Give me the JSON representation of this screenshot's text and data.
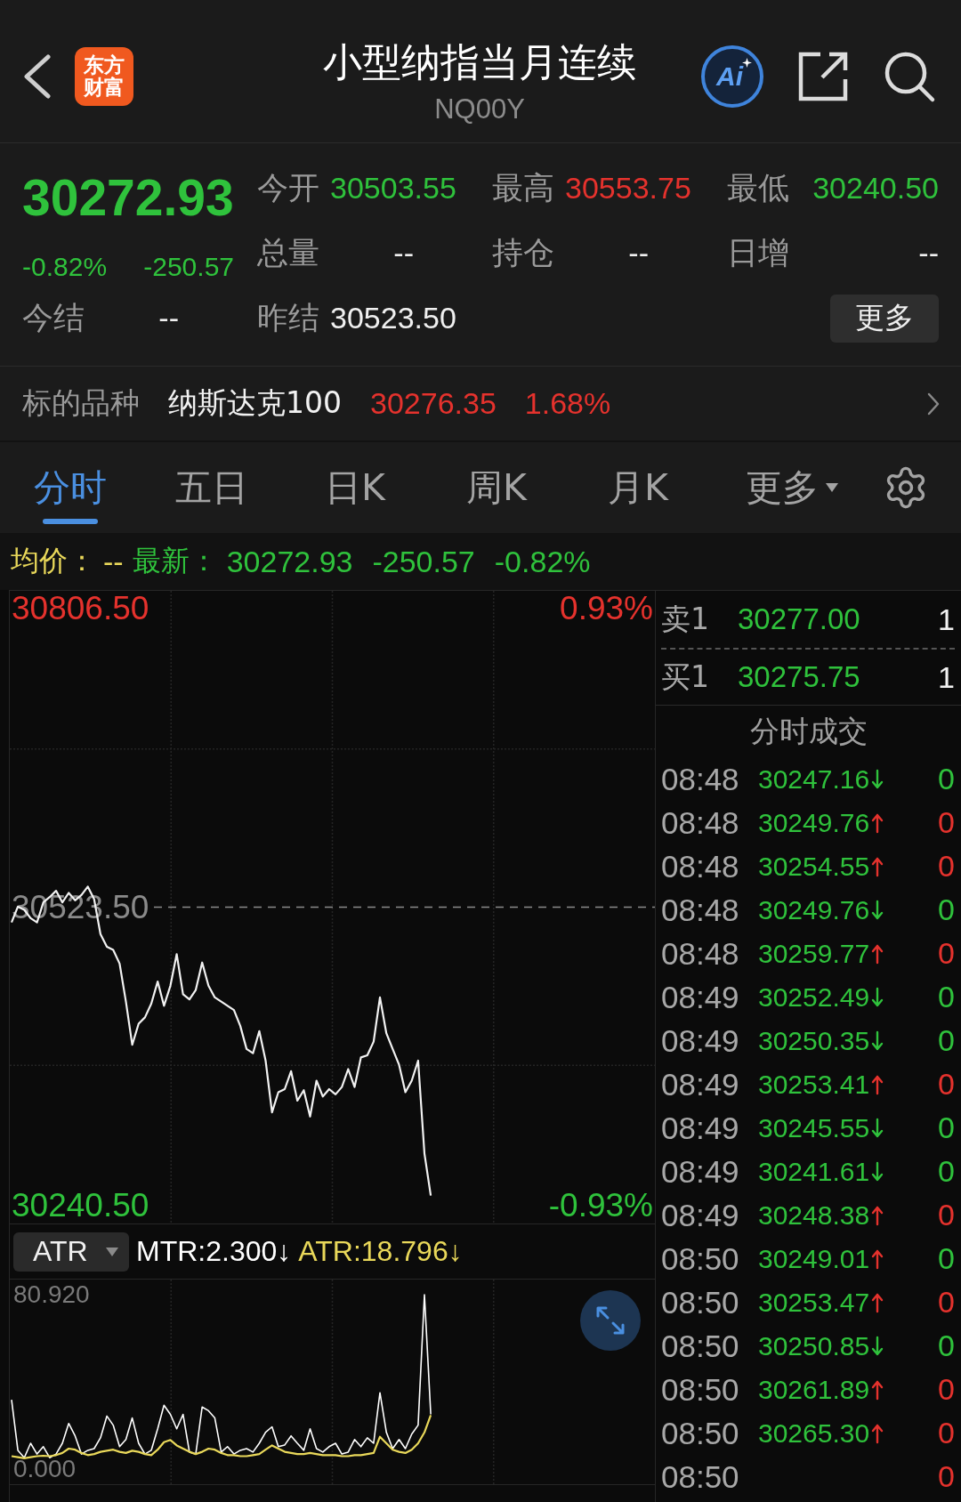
{
  "header": {
    "logo_lines": [
      "东方",
      "财富"
    ],
    "title": "小型纳指当月连续",
    "code": "NQ00Y",
    "ai_label": "Ai"
  },
  "quote": {
    "price": "30272.93",
    "change_pct": "-0.82%",
    "change": "-250.57",
    "stats": [
      {
        "label": "今开",
        "value": "30503.55",
        "color": "#2fc23c"
      },
      {
        "label": "最高",
        "value": "30553.75",
        "color": "#e5322d"
      },
      {
        "label": "最低",
        "value": "30240.50",
        "color": "#2fc23c"
      },
      {
        "label": "总量",
        "value": "--",
        "color": "#f0f0f0"
      },
      {
        "label": "持仓",
        "value": "--",
        "color": "#f0f0f0"
      },
      {
        "label": "日增",
        "value": "--",
        "color": "#f0f0f0"
      },
      {
        "label": "今结",
        "value": "--",
        "color": "#f0f0f0"
      },
      {
        "label": "昨结",
        "value": "30523.50",
        "color": "#f0f0f0"
      }
    ],
    "more_button": "更多"
  },
  "underlying": {
    "label": "标的品种",
    "name": "纳斯达克100",
    "price": "30276.35",
    "change_pct": "1.68%"
  },
  "tabs": [
    {
      "label": "分时",
      "selected": true,
      "kind": "tab"
    },
    {
      "label": "五日",
      "selected": false,
      "kind": "tab"
    },
    {
      "label": "日K",
      "selected": false,
      "kind": "tab"
    },
    {
      "label": "周K",
      "selected": false,
      "kind": "tab"
    },
    {
      "label": "月K",
      "selected": false,
      "kind": "tab"
    },
    {
      "label": "更多",
      "selected": false,
      "kind": "menu"
    }
  ],
  "summary": {
    "avg_label": "均价：",
    "avg_value": "--",
    "last_label": "最新：",
    "last_price": "30272.93",
    "change": "-250.57",
    "change_pct": "-0.82%"
  },
  "price_chart": {
    "right_labels": [
      {
        "text": "0.93%",
        "color": "#e5322d"
      },
      {
        "text": "-0.93%",
        "color": "#2fc23c"
      }
    ],
    "chart_data": {
      "type": "line",
      "ylim": [
        30223.6,
        30823.4
      ],
      "yticks": [
        {
          "value": 30806.5,
          "label": "30806.50"
        },
        {
          "value": 30523.5,
          "label": "30523.50"
        },
        {
          "value": 30240.5,
          "label": "30240.50"
        }
      ],
      "ref_lines": [
        {
          "axis": "y",
          "value": 30523.5
        }
      ],
      "values": [
        30509,
        30524,
        30521,
        30513,
        30509,
        30528,
        30533,
        30539,
        30528,
        30537,
        30530,
        30535,
        30543,
        30531,
        30498,
        30486,
        30483,
        30470,
        30434,
        30393,
        30413,
        30419,
        30432,
        30453,
        30430,
        30449,
        30479,
        30441,
        30436,
        30445,
        30471,
        30449,
        30438,
        30434,
        30430,
        30426,
        30411,
        30389,
        30385,
        30406,
        30378,
        30329,
        30348,
        30351,
        30368,
        30340,
        30350,
        30325,
        30359,
        30344,
        30351,
        30346,
        30353,
        30370,
        30353,
        30381,
        30383,
        30396,
        30438,
        30404,
        30389,
        30374,
        30348,
        30359,
        30378,
        30290,
        30250,
        null,
        null,
        null,
        null,
        null,
        null,
        null,
        null,
        null,
        null,
        null,
        null,
        null,
        null,
        null,
        null,
        null,
        null,
        null,
        null,
        null,
        null,
        null,
        null,
        null,
        null,
        null,
        null,
        null,
        null,
        null,
        null,
        null,
        null,
        null
      ]
    }
  },
  "indicator": {
    "selected": "ATR",
    "legend": [
      {
        "text": "MTR:2.300↓"
      },
      {
        "text": "ATR:18.796↓"
      }
    ],
    "chart_data": {
      "type": "line",
      "ylim": [
        -7.0,
        87.9
      ],
      "yticks": [
        {
          "value": 80.92,
          "label": "80.920"
        },
        {
          "value": 0,
          "label": "0.000"
        }
      ],
      "series": [
        {
          "color": "#ffffff",
          "values": [
            32.1,
            8.7,
            5.3,
            12.0,
            7.0,
            10.4,
            5.3,
            7.0,
            12.0,
            21.2,
            15.4,
            7.0,
            8.7,
            9.5,
            14.5,
            24.6,
            20.4,
            10.4,
            13.7,
            23.7,
            12.0,
            7.0,
            8.7,
            18.7,
            29.6,
            25.4,
            18.7,
            25.4,
            7.9,
            7.0,
            28.8,
            27.1,
            23.7,
            7.9,
            10.4,
            7.0,
            8.7,
            9.5,
            7.9,
            12.0,
            17.1,
            19.6,
            10.4,
            11.2,
            15.4,
            12.0,
            8.7,
            18.7,
            9.5,
            7.9,
            10.4,
            12.0,
            7.0,
            7.9,
            13.7,
            10.4,
            14.5,
            12.0,
            35.4,
            17.1,
            9.5,
            13.7,
            9.5,
            16.2,
            20.4,
            80.9,
            25.4,
            null,
            null,
            null,
            null,
            null,
            null,
            null,
            null,
            null,
            null,
            null,
            null,
            null,
            null,
            null,
            null,
            null,
            null,
            null,
            null,
            null,
            null,
            null,
            null,
            null,
            null,
            null,
            null,
            null,
            null,
            null,
            null,
            null,
            null,
            null
          ]
        },
        {
          "color": "#e9d85a",
          "values": [
            6.0,
            5.5,
            5.0,
            5.5,
            6.0,
            6.2,
            6.0,
            6.5,
            7.5,
            9.5,
            9.0,
            7.5,
            6.5,
            7.0,
            8.0,
            8.5,
            9.0,
            8.0,
            7.5,
            8.5,
            8.0,
            7.0,
            6.5,
            9.0,
            12.5,
            13.5,
            11.0,
            9.5,
            8.0,
            7.0,
            8.0,
            9.5,
            9.0,
            7.5,
            6.5,
            6.5,
            6.0,
            6.0,
            6.5,
            7.0,
            9.0,
            11.0,
            9.5,
            8.0,
            7.5,
            7.0,
            7.0,
            7.5,
            7.0,
            6.5,
            6.5,
            6.5,
            6.0,
            6.0,
            6.5,
            6.5,
            7.0,
            7.5,
            15.0,
            12.0,
            9.0,
            8.0,
            7.5,
            9.0,
            12.0,
            17.0,
            25.0,
            null,
            null,
            null,
            null,
            null,
            null,
            null,
            null,
            null,
            null,
            null,
            null,
            null,
            null,
            null,
            null,
            null,
            null,
            null,
            null,
            null,
            null,
            null,
            null,
            null,
            null,
            null,
            null,
            null,
            null,
            null,
            null,
            null,
            null,
            null
          ]
        }
      ]
    }
  },
  "order_book": [
    {
      "label": "卖1",
      "price": "30277.00",
      "volume": "1"
    },
    {
      "label": "买1",
      "price": "30275.75",
      "volume": "1"
    }
  ],
  "trades": {
    "title": "分时成交",
    "rows": [
      {
        "time": "08:48",
        "price": "30247.16",
        "up": false,
        "volume": "0",
        "color": "#2fc23c"
      },
      {
        "time": "08:48",
        "price": "30249.76",
        "up": true,
        "volume": "0",
        "color": "#e5322d"
      },
      {
        "time": "08:48",
        "price": "30254.55",
        "up": true,
        "volume": "0",
        "color": "#e5322d"
      },
      {
        "time": "08:48",
        "price": "30249.76",
        "up": false,
        "volume": "0",
        "color": "#2fc23c"
      },
      {
        "time": "08:48",
        "price": "30259.77",
        "up": true,
        "volume": "0",
        "color": "#e5322d"
      },
      {
        "time": "08:49",
        "price": "30252.49",
        "up": false,
        "volume": "0",
        "color": "#2fc23c"
      },
      {
        "time": "08:49",
        "price": "30250.35",
        "up": false,
        "volume": "0",
        "color": "#2fc23c"
      },
      {
        "time": "08:49",
        "price": "30253.41",
        "up": true,
        "volume": "0",
        "color": "#e5322d"
      },
      {
        "time": "08:49",
        "price": "30245.55",
        "up": false,
        "volume": "0",
        "color": "#2fc23c"
      },
      {
        "time": "08:49",
        "price": "30241.61",
        "up": false,
        "volume": "0",
        "color": "#2fc23c"
      },
      {
        "time": "08:49",
        "price": "30248.38",
        "up": true,
        "volume": "0",
        "color": "#e5322d"
      },
      {
        "time": "08:50",
        "price": "30249.01",
        "up": true,
        "volume": "0",
        "color": "#2fc23c"
      },
      {
        "time": "08:50",
        "price": "30253.47",
        "up": true,
        "volume": "0",
        "color": "#e5322d"
      },
      {
        "time": "08:50",
        "price": "30250.85",
        "up": false,
        "volume": "0",
        "color": "#2fc23c"
      },
      {
        "time": "08:50",
        "price": "30261.89",
        "up": true,
        "volume": "0",
        "color": "#e5322d"
      },
      {
        "time": "08:50",
        "price": "30265.30",
        "up": true,
        "volume": "0",
        "color": "#e5322d"
      },
      {
        "time": "08:50",
        "volume": "0",
        "color": "#e5322d"
      }
    ]
  }
}
